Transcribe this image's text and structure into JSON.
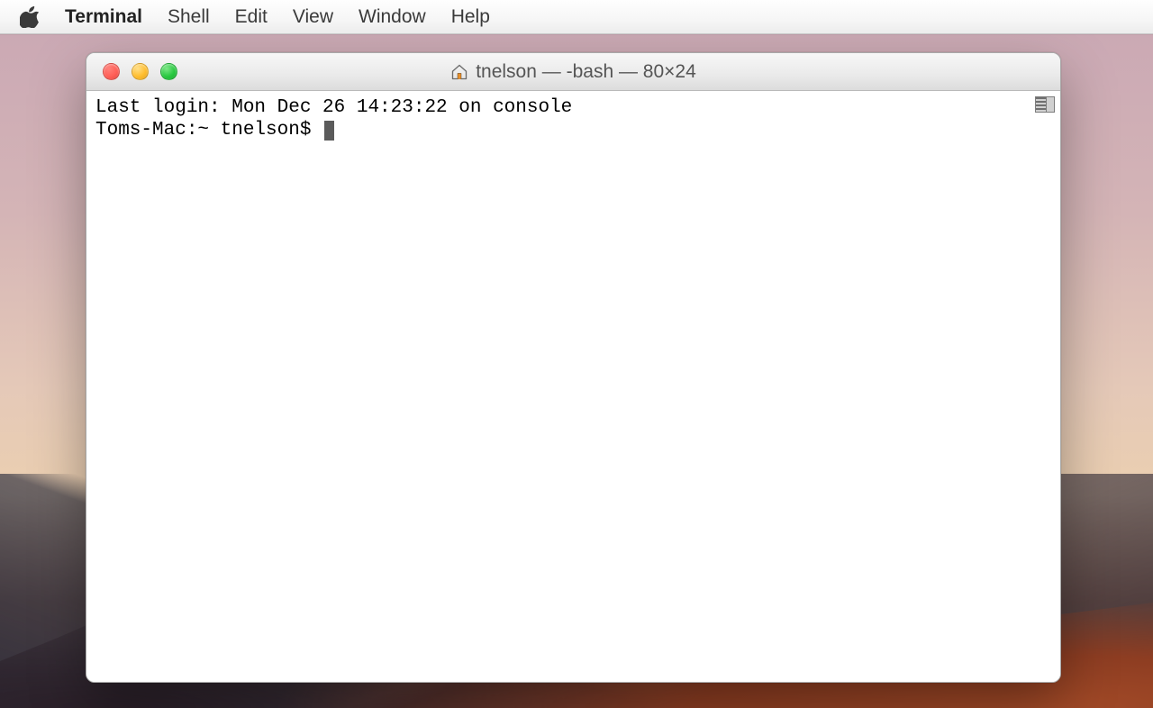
{
  "menubar": {
    "app_name": "Terminal",
    "items": [
      "Shell",
      "Edit",
      "View",
      "Window",
      "Help"
    ]
  },
  "window": {
    "title": "tnelson — -bash — 80×24",
    "traffic": {
      "close": "close",
      "minimize": "minimize",
      "zoom": "zoom"
    }
  },
  "terminal": {
    "last_login": "Last login: Mon Dec 26 14:23:22 on console",
    "prompt": "Toms-Mac:~ tnelson$ "
  }
}
